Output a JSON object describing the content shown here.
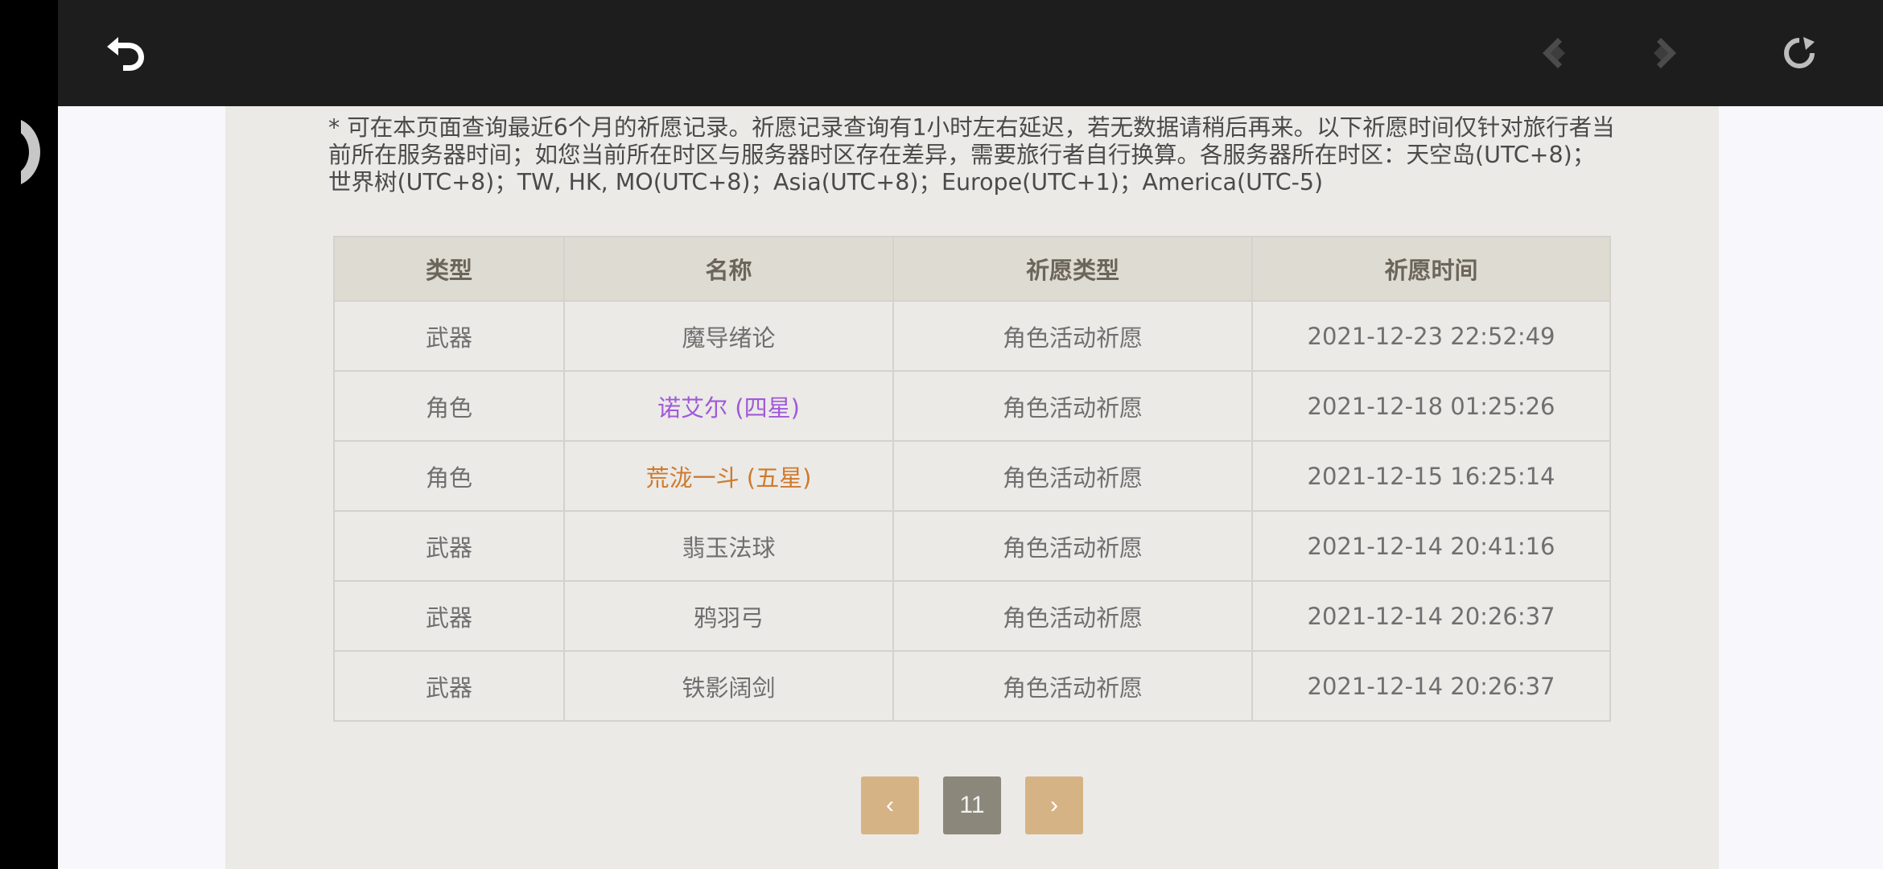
{
  "topbar": {
    "back_icon": "back-arrow-icon",
    "nav_prev_icon": "diamond-arrow-left-icon",
    "nav_next_icon": "diamond-arrow-right-icon",
    "refresh_icon": "refresh-icon"
  },
  "notice": "* 可在本页面查询最近6个月的祈愿记录。祈愿记录查询有1小时左右延迟，若无数据请稍后再来。以下祈愿时间仅针对旅行者当前所在服务器时间；如您当前所在时区与服务器时区存在差异，需要旅行者自行换算。各服务器所在时区：天空岛(UTC+8)；世界树(UTC+8)；TW, HK, MO(UTC+8)；Asia(UTC+8)；Europe(UTC+1)；America(UTC-5)",
  "table": {
    "headers": [
      "类型",
      "名称",
      "祈愿类型",
      "祈愿时间"
    ],
    "rows": [
      {
        "type": "武器",
        "name": "魔导绪论",
        "wish": "角色活动祈愿",
        "time": "2021-12-23 22:52:49"
      },
      {
        "type": "角色",
        "name": "诺艾尔 (四星)",
        "wish": "角色活动祈愿",
        "time": "2021-12-18 01:25:26"
      },
      {
        "type": "角色",
        "name": "荒泷一斗 (五星)",
        "wish": "角色活动祈愿",
        "time": "2021-12-15 16:25:14"
      },
      {
        "type": "武器",
        "name": "翡玉法球",
        "wish": "角色活动祈愿",
        "time": "2021-12-14 20:41:16"
      },
      {
        "type": "武器",
        "name": "鸦羽弓",
        "wish": "角色活动祈愿",
        "time": "2021-12-14 20:26:37"
      },
      {
        "type": "武器",
        "name": "铁影阔剑",
        "wish": "角色活动祈愿",
        "time": "2021-12-14 20:26:37"
      }
    ]
  },
  "pager": {
    "prev": "‹",
    "current": "11",
    "next": "›"
  },
  "colors": {
    "four_star": "#a05ad8",
    "five_star": "#cf7a2d",
    "pager_button": "#d6b385",
    "pager_current": "#8c877b"
  }
}
